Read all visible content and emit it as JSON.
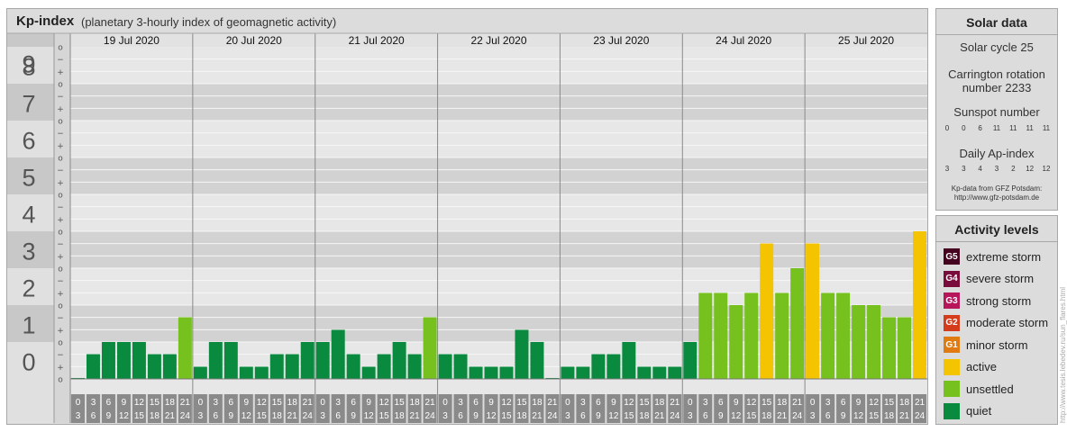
{
  "header": {
    "title": "Kp-index",
    "subtitle": "(planetary 3-hourly index of geomagnetic activity)"
  },
  "chart_data": {
    "type": "bar",
    "title": "Kp-index",
    "subtitle": "(planetary 3-hourly index of geomagnetic activity)",
    "ylim": [
      0,
      9
    ],
    "y_ticks": [
      "0",
      "1",
      "2",
      "3",
      "4",
      "5",
      "6",
      "7",
      "8",
      "9"
    ],
    "sub_ticks": [
      "+",
      "o",
      "−"
    ],
    "days": [
      "19 Jul 2020",
      "20 Jul 2020",
      "21 Jul 2020",
      "22 Jul 2020",
      "23 Jul 2020",
      "24 Jul 2020",
      "25 Jul 2020"
    ],
    "interval_start": [
      "0",
      "3",
      "6",
      "9",
      "12",
      "15",
      "18",
      "21"
    ],
    "interval_end": [
      "3",
      "6",
      "9",
      "12",
      "15",
      "18",
      "21",
      "24"
    ],
    "values": [
      0.0,
      0.67,
      1.0,
      1.0,
      1.0,
      0.67,
      0.67,
      1.67,
      0.33,
      1.0,
      1.0,
      0.33,
      0.33,
      0.67,
      0.67,
      1.0,
      1.0,
      1.33,
      0.67,
      0.33,
      0.67,
      1.0,
      0.67,
      1.67,
      0.67,
      0.67,
      0.33,
      0.33,
      0.33,
      1.33,
      1.0,
      0.0,
      0.33,
      0.33,
      0.67,
      0.67,
      1.0,
      0.33,
      0.33,
      0.33,
      1.0,
      2.33,
      2.33,
      2.0,
      2.33,
      3.67,
      2.33,
      3.0,
      3.67,
      2.33,
      2.33,
      2.0,
      2.0,
      1.67,
      1.67,
      4.0
    ],
    "colors": {
      "quiet": "#0a8a3e",
      "unsettled": "#76c11e",
      "active": "#f5c400",
      "G1": "#e07a12",
      "G2": "#d53c1c",
      "G3": "#b7165a",
      "G4": "#7a0c3c",
      "G5": "#45041f"
    },
    "grid": true
  },
  "solar": {
    "title": "Solar data",
    "cycle": "Solar cycle 25",
    "carrington_line1": "Carrington rotation",
    "carrington_line2": "number 2233",
    "sunspot_title": "Sunspot number",
    "sunspot_values": [
      "0",
      "0",
      "6",
      "11",
      "11",
      "11",
      "11"
    ],
    "ap_title": "Daily Ap-index",
    "ap_values": [
      "3",
      "3",
      "4",
      "3",
      "2",
      "12",
      "12"
    ],
    "source_line1": "Kp-data from GFZ Potsdam:",
    "source_line2": "http://www.gfz-potsdam.de"
  },
  "activity": {
    "title": "Activity levels",
    "levels": [
      {
        "badge": "G5",
        "label": "extreme storm",
        "color": "#45041f"
      },
      {
        "badge": "G4",
        "label": "severe storm",
        "color": "#7a0c3c"
      },
      {
        "badge": "G3",
        "label": "strong storm",
        "color": "#b7165a"
      },
      {
        "badge": "G2",
        "label": "moderate storm",
        "color": "#d53c1c"
      },
      {
        "badge": "G1",
        "label": "minor storm",
        "color": "#e07a12"
      },
      {
        "badge": "",
        "label": "active",
        "color": "#f5c400"
      },
      {
        "badge": "",
        "label": "unsettled",
        "color": "#76c11e"
      },
      {
        "badge": "",
        "label": "quiet",
        "color": "#0a8a3e"
      }
    ]
  },
  "credit": "http://www.tesis.lebedev.ru/sun_flares.html"
}
